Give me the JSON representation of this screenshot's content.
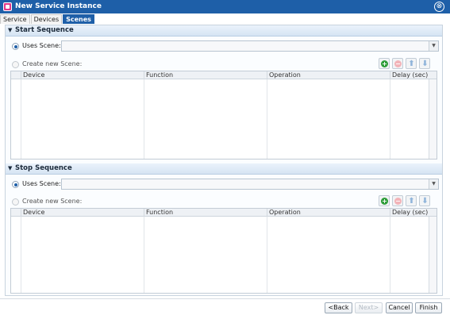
{
  "window": {
    "title": "New Service Instance",
    "close_label": "⊗"
  },
  "tabs": [
    {
      "label": "Service"
    },
    {
      "label": "Devices"
    },
    {
      "label": "Scenes"
    }
  ],
  "start_sequence": {
    "title": "Start Sequence",
    "uses_scene_label": "Uses Scene:",
    "uses_scene_value": "",
    "create_scene_label": "Create new Scene:",
    "columns": [
      "Device",
      "Function",
      "Operation",
      "Delay (sec)"
    ]
  },
  "stop_sequence": {
    "title": "Stop Sequence",
    "uses_scene_label": "Uses Scene:",
    "uses_scene_value": "",
    "create_scene_label": "Create new Scene:",
    "columns": [
      "Device",
      "Function",
      "Operation",
      "Delay (sec)"
    ]
  },
  "icons": {
    "add": "add-icon",
    "remove": "remove-icon",
    "up": "move-up-icon",
    "down": "move-down-icon"
  },
  "footer": {
    "back_label": "<Back",
    "next_label": "Next>",
    "cancel_label": "Cancel",
    "finish_label": "Finish"
  },
  "colors": {
    "accent": "#1e5fa8",
    "add_green": "#2e9d3a",
    "remove_pink": "#f2b3b8"
  }
}
